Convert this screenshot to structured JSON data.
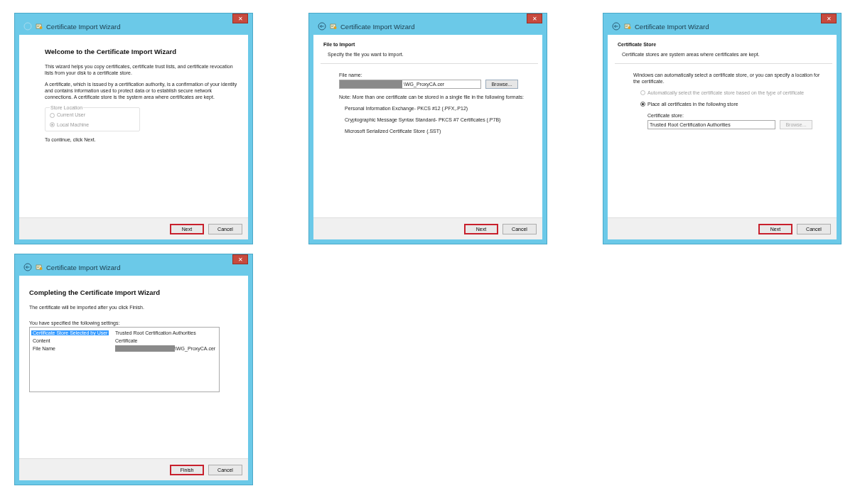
{
  "dialogs": [
    {
      "title": "Certificate Import Wizard",
      "close": "✕",
      "back_enabled": false,
      "page": {
        "kind": "welcome",
        "heading": "Welcome to the Certificate Import Wizard",
        "paragraphs": [
          "This wizard helps you copy certificates, certificate trust lists, and certificate revocation lists from your disk to a certificate store.",
          "A certificate, which is issued by a certification authority, is a confirmation of your identity and contains information used to protect data or to establish secure network connections. A certificate store is the system area where certificates are kept."
        ],
        "group": {
          "legend": "Store Location",
          "disabled": true,
          "options": [
            {
              "label": "Current User",
              "selected": false
            },
            {
              "label": "Local Machine",
              "selected": true
            }
          ]
        },
        "footer_text": "To continue, click Next."
      },
      "buttons": [
        {
          "label": "Next",
          "highlighted": true
        },
        {
          "label": "Cancel",
          "highlighted": false
        }
      ]
    },
    {
      "title": "Certificate Import Wizard",
      "close": "✕",
      "back_enabled": true,
      "page": {
        "kind": "file",
        "section_title": "File to Import",
        "section_subtitle": "Specify the file you want to import.",
        "field_label": "File name:",
        "field_value": "\\WG_ProxyCA.cer",
        "redacted": true,
        "browse": {
          "label": "Browse...",
          "disabled": false
        },
        "note": "Note:  More than one certificate can be stored in a single file in the following formats:",
        "formats": [
          "Personal Information Exchange- PKCS #12 (.PFX,.P12)",
          "Cryptographic Message Syntax Standard- PKCS #7 Certificates (.P7B)",
          "Microsoft Serialized Certificate Store (.SST)"
        ]
      },
      "buttons": [
        {
          "label": "Next",
          "highlighted": true
        },
        {
          "label": "Cancel",
          "highlighted": false
        }
      ]
    },
    {
      "title": "Certificate Import Wizard",
      "close": "✕",
      "back_enabled": true,
      "page": {
        "kind": "store",
        "section_title": "Certificate Store",
        "section_subtitle": "Certificate stores are system areas where certificates are kept.",
        "intro": "Windows can automatically select a certificate store, or you can specify a location for the certificate.",
        "options": [
          {
            "label": "Automatically select the certificate store based on the type of certificate",
            "selected": false,
            "disabled": true
          },
          {
            "label": "Place all certificates in the following store",
            "selected": true,
            "disabled": false
          }
        ],
        "field_label": "Certificate store:",
        "field_value": "Trusted Root Certification Authorities",
        "browse": {
          "label": "Browse...",
          "disabled": true
        }
      },
      "buttons": [
        {
          "label": "Next",
          "highlighted": true
        },
        {
          "label": "Cancel",
          "highlighted": false
        }
      ]
    },
    {
      "title": "Certificate Import Wizard",
      "close": "✕",
      "back_enabled": true,
      "page": {
        "kind": "complete",
        "heading": "Completing the Certificate Import Wizard",
        "paragraphs": [
          "The certificate will be imported after you click Finish."
        ],
        "list_label": "You have specified the following settings:",
        "settings": [
          {
            "name": "Certificate Store Selected by User",
            "value": "Trusted Root Certification Authorities",
            "selected": true,
            "redacted": false
          },
          {
            "name": "Content",
            "value": "Certificate",
            "selected": false,
            "redacted": false
          },
          {
            "name": "File Name",
            "value": "\\WG_ProxyCA.cer",
            "selected": false,
            "redacted": true
          }
        ]
      },
      "buttons": [
        {
          "label": "Finish",
          "highlighted": true
        },
        {
          "label": "Cancel",
          "highlighted": false
        }
      ]
    }
  ]
}
